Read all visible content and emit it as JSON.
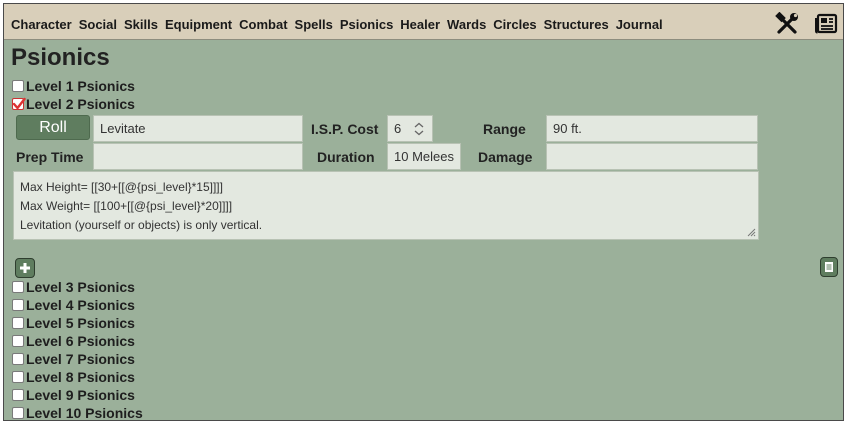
{
  "nav": {
    "items": [
      "Character",
      "Social",
      "Skills",
      "Equipment",
      "Combat",
      "Spells",
      "Psionics",
      "Healer",
      "Wards",
      "Circles",
      "Structures",
      "Journal"
    ],
    "tools_icon": "crossed-hammer-wrench-icon",
    "journal_icon": "newspaper-icon"
  },
  "page": {
    "title": "Psionics"
  },
  "levels": [
    {
      "label": "Level 1 Psionics",
      "checked": false
    },
    {
      "label": "Level 2 Psionics",
      "checked": true
    },
    {
      "label": "Level 3 Psionics",
      "checked": false
    },
    {
      "label": "Level 4 Psionics",
      "checked": false
    },
    {
      "label": "Level 5 Psionics",
      "checked": false
    },
    {
      "label": "Level 6 Psionics",
      "checked": false
    },
    {
      "label": "Level 7 Psionics",
      "checked": false
    },
    {
      "label": "Level 8 Psionics",
      "checked": false
    },
    {
      "label": "Level 9 Psionics",
      "checked": false
    },
    {
      "label": "Level 10 Psionics",
      "checked": false
    }
  ],
  "power": {
    "roll_label": "Roll",
    "name": "Levitate",
    "isp_label": "I.S.P. Cost",
    "isp_value": "6",
    "range_label": "Range",
    "range_value": "90 ft.",
    "prep_label": "Prep Time",
    "prep_value": "",
    "duration_label": "Duration",
    "duration_value": "10 Melees",
    "damage_label": "Damage",
    "damage_value": "",
    "description": [
      "Max Height= [[30+[[@{psi_level}*15]]]]",
      "Max Weight= [[100+[[@{psi_level}*20]]]]",
      "Levitation (yourself or objects) is only vertical."
    ]
  },
  "colors": {
    "panel_bg": "#9bb09a",
    "nav_bg": "#d9cfba",
    "button_green": "#5f7d5f",
    "field_bg": "#e3e8e0",
    "check_red": "#d33"
  }
}
